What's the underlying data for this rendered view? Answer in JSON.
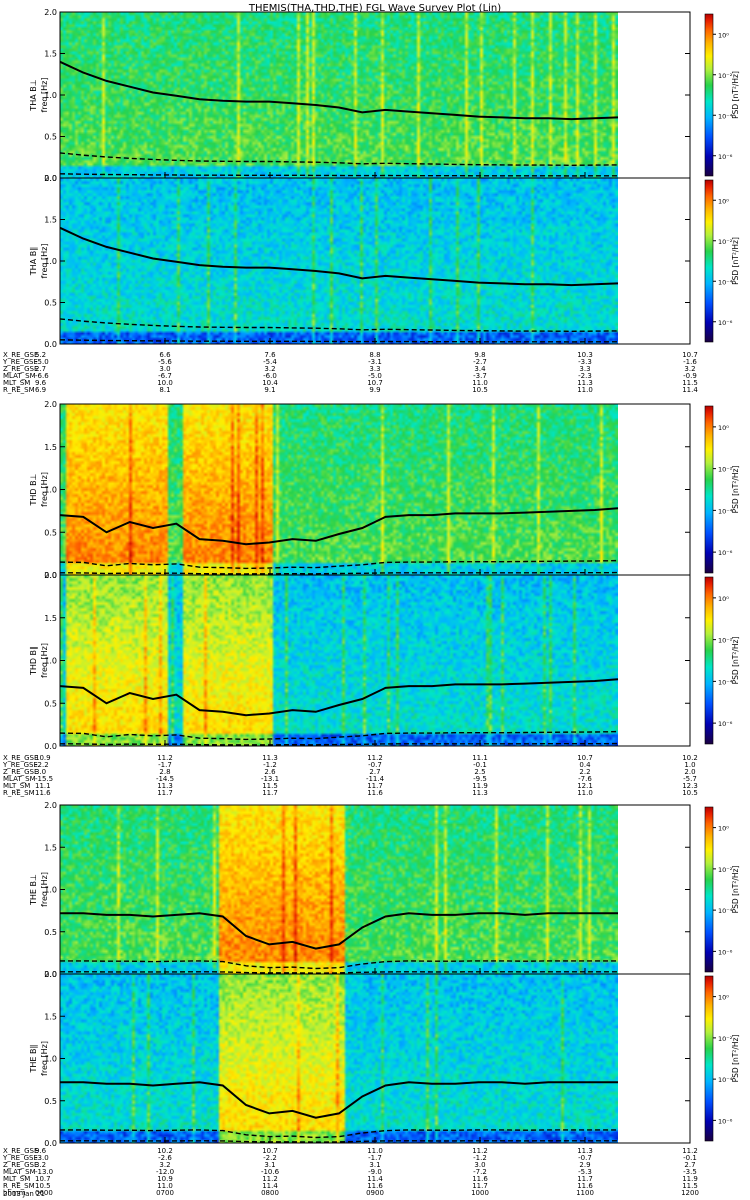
{
  "title": "THEMIS(THA,THD,THE) FGL Wave Survey Plot (Lin)",
  "date_label": "2013 Jan 21",
  "colors": {
    "colormap": [
      "#1a0040",
      "#0000b4",
      "#0050ff",
      "#00b4ff",
      "#00e6c8",
      "#28d24b",
      "#b4f03c",
      "#fff000",
      "#ffb400",
      "#ff6400",
      "#e61e00",
      "#b40000"
    ],
    "line": "#000000"
  },
  "colorbar": {
    "label": "PSD [nT²/Hz]",
    "ticks": [
      {
        "label": "10⁰",
        "value": 0
      },
      {
        "label": "10⁻²",
        "value": -2
      },
      {
        "label": "10⁻⁴",
        "value": -4
      },
      {
        "label": "10⁻⁶",
        "value": -6
      }
    ],
    "range": [
      -7,
      1
    ]
  },
  "chart_data": {
    "type": "heatmap",
    "x": {
      "range": [
        600,
        1200
      ],
      "unit": "hhmm"
    },
    "ylim": [
      0,
      2.0
    ],
    "y_ticks": [
      "0.0",
      "0.5",
      "1.0",
      "1.5",
      "2.0"
    ],
    "ylabel": "freq [Hz]",
    "probes": [
      {
        "id": "tha",
        "panels": [
          {
            "label": "THA B⊥",
            "activity": [],
            "fce_line": [
              1.4,
              1.27,
              1.17,
              1.1,
              1.03,
              0.99,
              0.95,
              0.93,
              0.92,
              0.92,
              0.9,
              0.88,
              0.85,
              0.79,
              0.82,
              0.8,
              0.78,
              0.76,
              0.74,
              0.73,
              0.72,
              0.72,
              0.71,
              0.72,
              0.73
            ]
          },
          {
            "label": "THA B∥",
            "activity": [],
            "fce_line": [
              1.4,
              1.27,
              1.17,
              1.1,
              1.03,
              0.99,
              0.95,
              0.93,
              0.92,
              0.92,
              0.9,
              0.88,
              0.85,
              0.79,
              0.82,
              0.8,
              0.78,
              0.76,
              0.74,
              0.73,
              0.72,
              0.72,
              0.71,
              0.72,
              0.73
            ]
          }
        ],
        "orbit": {
          "labels": [
            "X_RE_GSE",
            "Y_RE_GSE",
            "Z_RE_GSE",
            "MLAT_SM",
            "MLT_SM",
            "R_RE_SM"
          ],
          "values": [
            [
              "5.2",
              "6.6",
              "7.6",
              "8.8",
              "9.8",
              "10.3",
              "10.7"
            ],
            [
              "-5.0",
              "-5.6",
              "-5.4",
              "-3.1",
              "-2.7",
              "-3.3",
              "-1.6"
            ],
            [
              "2.7",
              "3.0",
              "3.2",
              "3.3",
              "3.4",
              "3.3",
              "3.2"
            ],
            [
              "-6.6",
              "-6.7",
              "-6.0",
              "-5.0",
              "-3.7",
              "-2.3",
              "-0.9"
            ],
            [
              "9.6",
              "10.0",
              "10.4",
              "10.7",
              "11.0",
              "11.3",
              "11.5"
            ],
            [
              "6.9",
              "8.1",
              "9.1",
              "9.9",
              "10.5",
              "11.0",
              "11.4"
            ]
          ]
        }
      },
      {
        "id": "thd",
        "panels": [
          {
            "label": "THD B⊥",
            "activity": [
              [
                605,
                700
              ],
              [
                715,
                800
              ]
            ],
            "fce_line": [
              0.7,
              0.68,
              0.5,
              0.62,
              0.55,
              0.6,
              0.42,
              0.4,
              0.36,
              0.38,
              0.42,
              0.4,
              0.48,
              0.55,
              0.68,
              0.7,
              0.7,
              0.72,
              0.72,
              0.72,
              0.73,
              0.74,
              0.75,
              0.76,
              0.78
            ]
          },
          {
            "label": "THD B∥",
            "activity": [
              [
                605,
                700
              ],
              [
                715,
                800
              ]
            ],
            "fce_line": [
              0.7,
              0.68,
              0.5,
              0.62,
              0.55,
              0.6,
              0.42,
              0.4,
              0.36,
              0.38,
              0.42,
              0.4,
              0.48,
              0.55,
              0.68,
              0.7,
              0.7,
              0.72,
              0.72,
              0.72,
              0.73,
              0.74,
              0.75,
              0.76,
              0.78
            ]
          }
        ],
        "orbit": {
          "labels": [
            "X_RE_GSE",
            "Y_RE_GSE",
            "Z_RE_GSE",
            "MLAT_SM",
            "MLT_SM",
            "R_RE_SM"
          ],
          "values": [
            [
              "10.9",
              "11.2",
              "11.3",
              "11.2",
              "11.1",
              "10.7",
              "10.2"
            ],
            [
              "-2.2",
              "-1.7",
              "-1.2",
              "-0.7",
              "-0.1",
              "0.4",
              "1.0"
            ],
            [
              "3.0",
              "2.8",
              "2.6",
              "2.7",
              "2.5",
              "2.2",
              "2.0"
            ],
            [
              "-15.5",
              "-14.5",
              "-13.1",
              "-11.4",
              "-9.5",
              "-7.6",
              "-5.7"
            ],
            [
              "11.1",
              "11.3",
              "11.5",
              "11.7",
              "11.9",
              "12.1",
              "12.3"
            ],
            [
              "11.6",
              "11.7",
              "11.7",
              "11.6",
              "11.3",
              "11.0",
              "10.5"
            ]
          ]
        }
      },
      {
        "id": "the",
        "panels": [
          {
            "label": "THE B⊥",
            "activity": [
              [
                750,
                870
              ]
            ],
            "fce_line": [
              0.72,
              0.72,
              0.7,
              0.7,
              0.68,
              0.7,
              0.72,
              0.68,
              0.45,
              0.35,
              0.38,
              0.3,
              0.35,
              0.55,
              0.68,
              0.72,
              0.7,
              0.7,
              0.72,
              0.72,
              0.7,
              0.72,
              0.72,
              0.72,
              0.72
            ]
          },
          {
            "label": "THE B∥",
            "activity": [
              [
                750,
                870
              ]
            ],
            "fce_line": [
              0.72,
              0.72,
              0.7,
              0.7,
              0.68,
              0.7,
              0.72,
              0.68,
              0.45,
              0.35,
              0.38,
              0.3,
              0.35,
              0.55,
              0.68,
              0.72,
              0.7,
              0.7,
              0.72,
              0.72,
              0.7,
              0.72,
              0.72,
              0.72,
              0.72
            ]
          }
        ],
        "orbit": {
          "labels": [
            "X_RE_GSE",
            "Y_RE_GSE",
            "Z_RE_GSE",
            "MLAT_SM",
            "MLT_SM",
            "R_RE_SM",
            "hhmm"
          ],
          "values": [
            [
              "9.6",
              "10.2",
              "10.7",
              "11.0",
              "11.2",
              "11.3",
              "11.2"
            ],
            [
              "-3.0",
              "-2.6",
              "-2.2",
              "-1.7",
              "-1.2",
              "-0.7",
              "-0.1"
            ],
            [
              "3.2",
              "3.2",
              "3.1",
              "3.1",
              "3.0",
              "2.9",
              "2.7"
            ],
            [
              "-13.0",
              "-12.0",
              "-10.6",
              "-9.0",
              "-7.2",
              "-5.3",
              "-3.5"
            ],
            [
              "10.7",
              "10.9",
              "11.2",
              "11.4",
              "11.6",
              "11.7",
              "11.9"
            ],
            [
              "10.5",
              "11.0",
              "11.4",
              "11.6",
              "11.7",
              "11.6",
              "11.5"
            ],
            [
              "0600",
              "0700",
              "0800",
              "0900",
              "1000",
              "1100",
              "1200"
            ]
          ]
        }
      }
    ]
  }
}
